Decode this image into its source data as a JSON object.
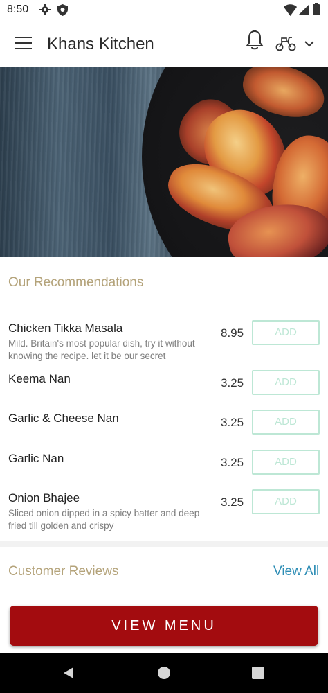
{
  "status_bar": {
    "time": "8:50"
  },
  "app_bar": {
    "title": "Khans Kitchen"
  },
  "recommendations": {
    "title": "Our Recommendations",
    "items": [
      {
        "name": "Chicken Tikka Masala",
        "description": "Mild. Britain's most popular dish, try it without knowing the recipe. let it be our secret",
        "price": "8.95",
        "button": "ADD"
      },
      {
        "name": "Keema Nan",
        "description": "",
        "price": "3.25",
        "button": "ADD"
      },
      {
        "name": "Garlic & Cheese Nan",
        "description": "",
        "price": "3.25",
        "button": "ADD"
      },
      {
        "name": "Garlic Nan",
        "description": "",
        "price": "3.25",
        "button": "ADD"
      },
      {
        "name": "Onion Bhajee",
        "description": "Sliced onion dipped in a spicy batter and deep fried till golden and crispy",
        "price": "3.25",
        "button": "ADD"
      }
    ]
  },
  "reviews": {
    "title": "Customer Reviews",
    "view_all": "View All"
  },
  "footer": {
    "view_menu": "VIEW MENU"
  },
  "colors": {
    "accent_gold": "#b4a37a",
    "brand_red": "#a30c0f",
    "add_border": "#bde7d5",
    "link_blue": "#2d8db5"
  }
}
